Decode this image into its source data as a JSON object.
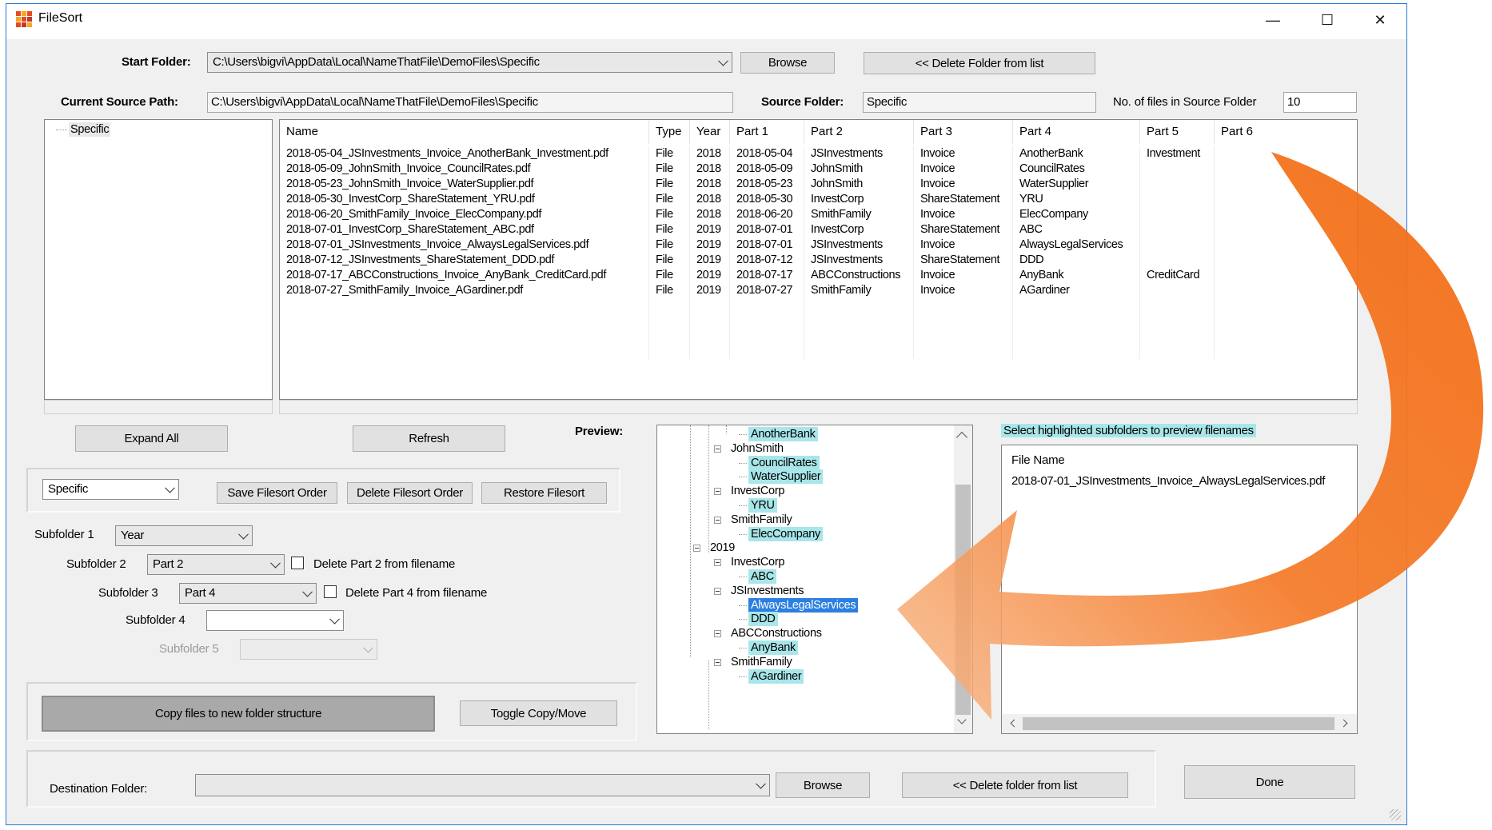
{
  "window": {
    "title": "FileSort",
    "controls": [
      "—",
      "☐",
      "✕"
    ]
  },
  "start_folder": {
    "label": "Start Folder:",
    "value": "C:\\Users\\bigvi\\AppData\\Local\\NameThatFile\\DemoFiles\\Specific",
    "browse": "Browse",
    "delete": "<< Delete Folder from list"
  },
  "current_source": {
    "label": "Current Source Path:",
    "value": "C:\\Users\\bigvi\\AppData\\Local\\NameThatFile\\DemoFiles\\Specific"
  },
  "source_folder": {
    "label": "Source Folder:",
    "value": "Specific"
  },
  "file_count": {
    "label": "No. of files in Source Folder",
    "value": "10"
  },
  "folder_tree": {
    "root": "Specific"
  },
  "grid": {
    "columns": [
      "Name",
      "Type",
      "Year",
      "Part 1",
      "Part 2",
      "Part 3",
      "Part 4",
      "Part 5",
      "Part 6"
    ],
    "rows": [
      [
        "2018-05-04_JSInvestments_Invoice_AnotherBank_Investment.pdf",
        "File",
        "2018",
        "2018-05-04",
        "JSInvestments",
        "Invoice",
        "AnotherBank",
        "Investment",
        ""
      ],
      [
        "2018-05-09_JohnSmith_Invoice_CouncilRates.pdf",
        "File",
        "2018",
        "2018-05-09",
        "JohnSmith",
        "Invoice",
        "CouncilRates",
        "",
        ""
      ],
      [
        "2018-05-23_JohnSmith_Invoice_WaterSupplier.pdf",
        "File",
        "2018",
        "2018-05-23",
        "JohnSmith",
        "Invoice",
        "WaterSupplier",
        "",
        ""
      ],
      [
        "2018-05-30_InvestCorp_ShareStatement_YRU.pdf",
        "File",
        "2018",
        "2018-05-30",
        "InvestCorp",
        "ShareStatement",
        "YRU",
        "",
        ""
      ],
      [
        "2018-06-20_SmithFamily_Invoice_ElecCompany.pdf",
        "File",
        "2018",
        "2018-06-20",
        "SmithFamily",
        "Invoice",
        "ElecCompany",
        "",
        ""
      ],
      [
        "2018-07-01_InvestCorp_ShareStatement_ABC.pdf",
        "File",
        "2019",
        "2018-07-01",
        "InvestCorp",
        "ShareStatement",
        "ABC",
        "",
        ""
      ],
      [
        "2018-07-01_JSInvestments_Invoice_AlwaysLegalServices.pdf",
        "File",
        "2019",
        "2018-07-01",
        "JSInvestments",
        "Invoice",
        "AlwaysLegalServices",
        "",
        ""
      ],
      [
        "2018-07-12_JSInvestments_ShareStatement_DDD.pdf",
        "File",
        "2019",
        "2018-07-12",
        "JSInvestments",
        "ShareStatement",
        "DDD",
        "",
        ""
      ],
      [
        "2018-07-17_ABCConstructions_Invoice_AnyBank_CreditCard.pdf",
        "File",
        "2019",
        "2018-07-17",
        "ABCConstructions",
        "Invoice",
        "AnyBank",
        "CreditCard",
        ""
      ],
      [
        "2018-07-27_SmithFamily_Invoice_AGardiner.pdf",
        "File",
        "2019",
        "2018-07-27",
        "SmithFamily",
        "Invoice",
        "AGardiner",
        "",
        ""
      ]
    ]
  },
  "buttons": {
    "expand_all": "Expand All",
    "refresh": "Refresh",
    "save_order": "Save Filesort Order",
    "delete_order": "Delete Filesort Order",
    "restore": "Restore Filesort",
    "copy": "Copy files to new folder structure",
    "toggle": "Toggle Copy/Move",
    "dest_browse": "Browse",
    "dest_delete": "<< Delete folder from list",
    "done": "Done"
  },
  "order_combo": "Specific",
  "subfolders": [
    {
      "label": "Subfolder 1",
      "value": "Year"
    },
    {
      "label": "Subfolder 2",
      "value": "Part 2",
      "delete_label": "Delete Part 2 from filename"
    },
    {
      "label": "Subfolder 3",
      "value": "Part 4",
      "delete_label": "Delete Part 4 from filename"
    },
    {
      "label": "Subfolder 4",
      "value": ""
    },
    {
      "label": "Subfolder 5",
      "value": ""
    }
  ],
  "preview": {
    "label": "Preview:",
    "tree": [
      {
        "text": "AnotherBank",
        "style": "hl"
      },
      {
        "text": "JohnSmith",
        "style": ""
      },
      {
        "text": "CouncilRates",
        "style": "hl"
      },
      {
        "text": "WaterSupplier",
        "style": "hl"
      },
      {
        "text": "InvestCorp",
        "style": ""
      },
      {
        "text": "YRU",
        "style": "hl"
      },
      {
        "text": "SmithFamily",
        "style": ""
      },
      {
        "text": "ElecCompany",
        "style": "hl"
      },
      {
        "text": "2019",
        "style": ""
      },
      {
        "text": "InvestCorp",
        "style": ""
      },
      {
        "text": "ABC",
        "style": "hl"
      },
      {
        "text": "JSInvestments",
        "style": ""
      },
      {
        "text": "AlwaysLegalServices",
        "style": "sel"
      },
      {
        "text": "DDD",
        "style": "hl"
      },
      {
        "text": "ABCConstructions",
        "style": ""
      },
      {
        "text": "AnyBank",
        "style": "hl"
      },
      {
        "text": "SmithFamily",
        "style": ""
      },
      {
        "text": "AGardiner",
        "style": "hl"
      }
    ],
    "hint": "Select highlighted subfolders to preview filenames",
    "file_list_header": "File Name",
    "files": [
      "2018-07-01_JSInvestments_Invoice_AlwaysLegalServices.pdf"
    ]
  },
  "destination": {
    "label": "Destination Folder:",
    "value": ""
  },
  "colors": {
    "highlight": "#a8e6ea",
    "selected": "#2b7fe0",
    "arrow": "#f26a10"
  }
}
